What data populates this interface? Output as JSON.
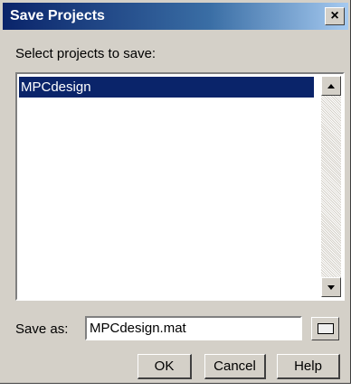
{
  "window": {
    "title": "Save Projects",
    "close_glyph": "×"
  },
  "prompt": "Select projects to save:",
  "projects": {
    "items": [
      {
        "label": "MPCdesign",
        "selected": true
      }
    ]
  },
  "save_as": {
    "label": "Save as:",
    "value": "MPCdesign.mat"
  },
  "buttons": {
    "ok": "OK",
    "cancel": "Cancel",
    "help": "Help"
  },
  "icons": {
    "close": "close-icon",
    "scroll_up": "scroll-up-arrow-icon",
    "scroll_down": "scroll-down-arrow-icon",
    "browse": "folder-browse-icon"
  },
  "colors": {
    "title_bar": "#0a246a",
    "selection": "#0a246a",
    "dialog_bg": "#d4d0c8"
  }
}
